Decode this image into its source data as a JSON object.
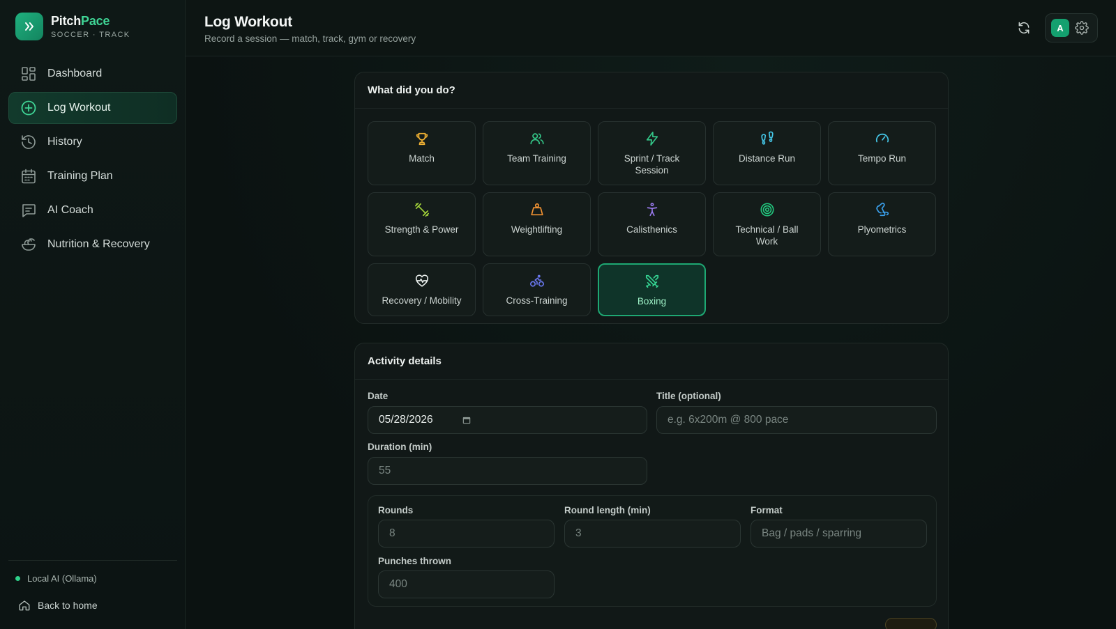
{
  "brand": {
    "name_part1": "Pitch",
    "name_part2": "Pace",
    "subtitle": "SOCCER · TRACK"
  },
  "nav": [
    {
      "label": "Dashboard",
      "icon": "dashboard-icon",
      "active": false
    },
    {
      "label": "Log Workout",
      "icon": "plus-circle-icon",
      "active": true
    },
    {
      "label": "History",
      "icon": "history-icon",
      "active": false
    },
    {
      "label": "Training Plan",
      "icon": "calendar-icon",
      "active": false
    },
    {
      "label": "AI Coach",
      "icon": "chat-icon",
      "active": false
    },
    {
      "label": "Nutrition & Recovery",
      "icon": "salad-bowl-icon",
      "active": false
    }
  ],
  "footer": {
    "ai_status": "Local AI (Ollama)",
    "back_home": "Back to home"
  },
  "header": {
    "title": "Log Workout",
    "subtitle": "Record a session — match, track, gym or recovery",
    "avatar_initial": "A"
  },
  "activity_card": {
    "title": "What did you do?",
    "activities": [
      {
        "label": "Match",
        "icon": "trophy-icon",
        "color": "#f2b233"
      },
      {
        "label": "Team Training",
        "icon": "users-icon",
        "color": "#34c98a"
      },
      {
        "label": "Sprint / Track Session",
        "icon": "lightning-icon",
        "color": "#34c98a"
      },
      {
        "label": "Distance Run",
        "icon": "footprints-icon",
        "color": "#45c7e8"
      },
      {
        "label": "Tempo Run",
        "icon": "gauge-icon",
        "color": "#45c7e8"
      },
      {
        "label": "Strength & Power",
        "icon": "dumbbell-icon",
        "color": "#a4d53a"
      },
      {
        "label": "Weightlifting",
        "icon": "weight-icon",
        "color": "#f39333"
      },
      {
        "label": "Calisthenics",
        "icon": "person-stretch-icon",
        "color": "#9b7bf0"
      },
      {
        "label": "Technical / Ball Work",
        "icon": "target-icon",
        "color": "#22c77e"
      },
      {
        "label": "Plyometrics",
        "icon": "rabbit-icon",
        "color": "#3aa0ec"
      },
      {
        "label": "Recovery / Mobility",
        "icon": "heart-pulse-icon",
        "color": "#e9eeec"
      },
      {
        "label": "Cross-Training",
        "icon": "bike-icon",
        "color": "#6a78f0"
      },
      {
        "label": "Boxing",
        "icon": "swords-icon",
        "color": "#35d493",
        "selected": true
      }
    ]
  },
  "details_card": {
    "title": "Activity details",
    "date_label": "Date",
    "date_value": "05/28/2026",
    "title_label": "Title (optional)",
    "title_placeholder": "e.g. 6x200m @ 800 pace",
    "duration_label": "Duration (min)",
    "duration_placeholder": "55",
    "rounds_label": "Rounds",
    "rounds_placeholder": "8",
    "round_length_label": "Round length (min)",
    "round_length_placeholder": "3",
    "format_label": "Format",
    "format_placeholder": "Bag / pads / sparring",
    "punches_label": "Punches thrown",
    "punches_placeholder": "400"
  }
}
